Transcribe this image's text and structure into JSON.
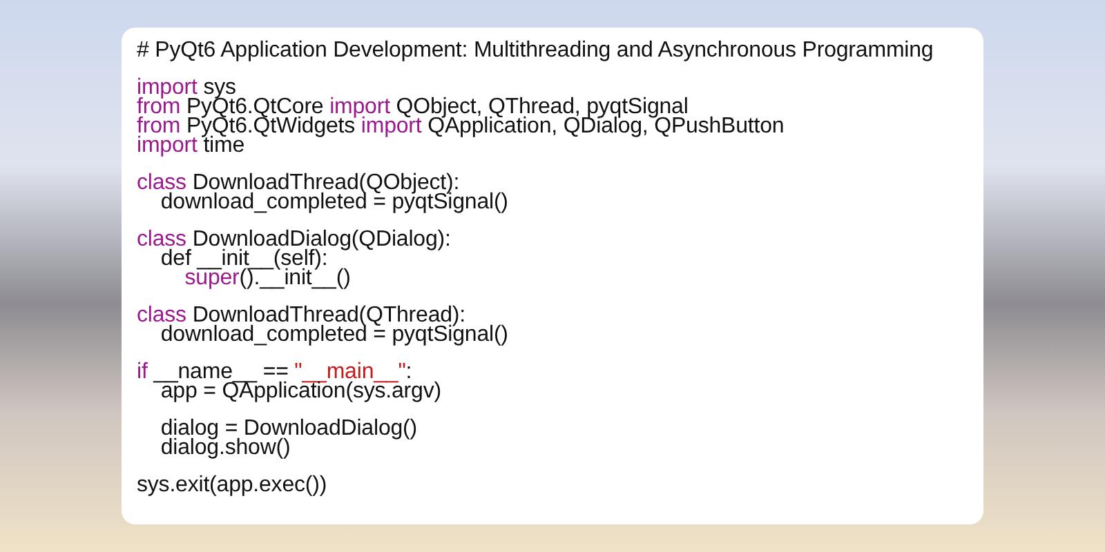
{
  "code_card": {
    "blocks": [
      {
        "lines": [
          [
            {
              "kind": "comment",
              "text": "# PyQt6 Application Development: Multithreading and Asynchronous Programming"
            }
          ]
        ]
      },
      {
        "lines": [
          [
            {
              "kind": "keyword",
              "text": "import"
            },
            {
              "kind": "plain",
              "text": " sys"
            }
          ],
          [
            {
              "kind": "keyword",
              "text": "from"
            },
            {
              "kind": "plain",
              "text": " PyQt6.QtCore "
            },
            {
              "kind": "keyword",
              "text": "import"
            },
            {
              "kind": "plain",
              "text": " QObject, QThread, pyqtSignal"
            }
          ],
          [
            {
              "kind": "keyword",
              "text": "from"
            },
            {
              "kind": "plain",
              "text": " PyQt6.QtWidgets "
            },
            {
              "kind": "keyword",
              "text": "import"
            },
            {
              "kind": "plain",
              "text": " QApplication, QDialog, QPushButton"
            }
          ],
          [
            {
              "kind": "keyword",
              "text": "import"
            },
            {
              "kind": "plain",
              "text": " time"
            }
          ]
        ]
      },
      {
        "lines": [
          [
            {
              "kind": "keyword",
              "text": "class"
            },
            {
              "kind": "plain",
              "text": " DownloadThread(QObject):"
            }
          ],
          [
            {
              "kind": "plain",
              "text": "    download_completed = pyqtSignal()"
            }
          ]
        ]
      },
      {
        "lines": [
          [
            {
              "kind": "keyword",
              "text": "class"
            },
            {
              "kind": "plain",
              "text": " DownloadDialog(QDialog):"
            }
          ],
          [
            {
              "kind": "plain",
              "text": "    def __init__(self):"
            }
          ],
          [
            {
              "kind": "keyword",
              "text": "        super"
            },
            {
              "kind": "plain",
              "text": "().__init__()"
            }
          ]
        ]
      },
      {
        "lines": [
          [
            {
              "kind": "keyword",
              "text": "class"
            },
            {
              "kind": "plain",
              "text": " DownloadThread(QThread):"
            }
          ],
          [
            {
              "kind": "plain",
              "text": "    download_completed = pyqtSignal()"
            }
          ]
        ]
      },
      {
        "lines": [
          [
            {
              "kind": "keyword",
              "text": "if"
            },
            {
              "kind": "plain",
              "text": " __name__ == "
            },
            {
              "kind": "string",
              "text": "\"__main__\""
            },
            {
              "kind": "plain",
              "text": ":"
            }
          ],
          [
            {
              "kind": "plain",
              "text": "    app = QApplication(sys.argv)"
            }
          ]
        ]
      },
      {
        "lines": [
          [
            {
              "kind": "plain",
              "text": "    dialog = DownloadDialog()"
            }
          ],
          [
            {
              "kind": "plain",
              "text": "    dialog.show()"
            }
          ]
        ]
      },
      {
        "lines": [
          [
            {
              "kind": "plain",
              "text": "sys.exit(app.exec())"
            }
          ]
        ]
      }
    ]
  }
}
